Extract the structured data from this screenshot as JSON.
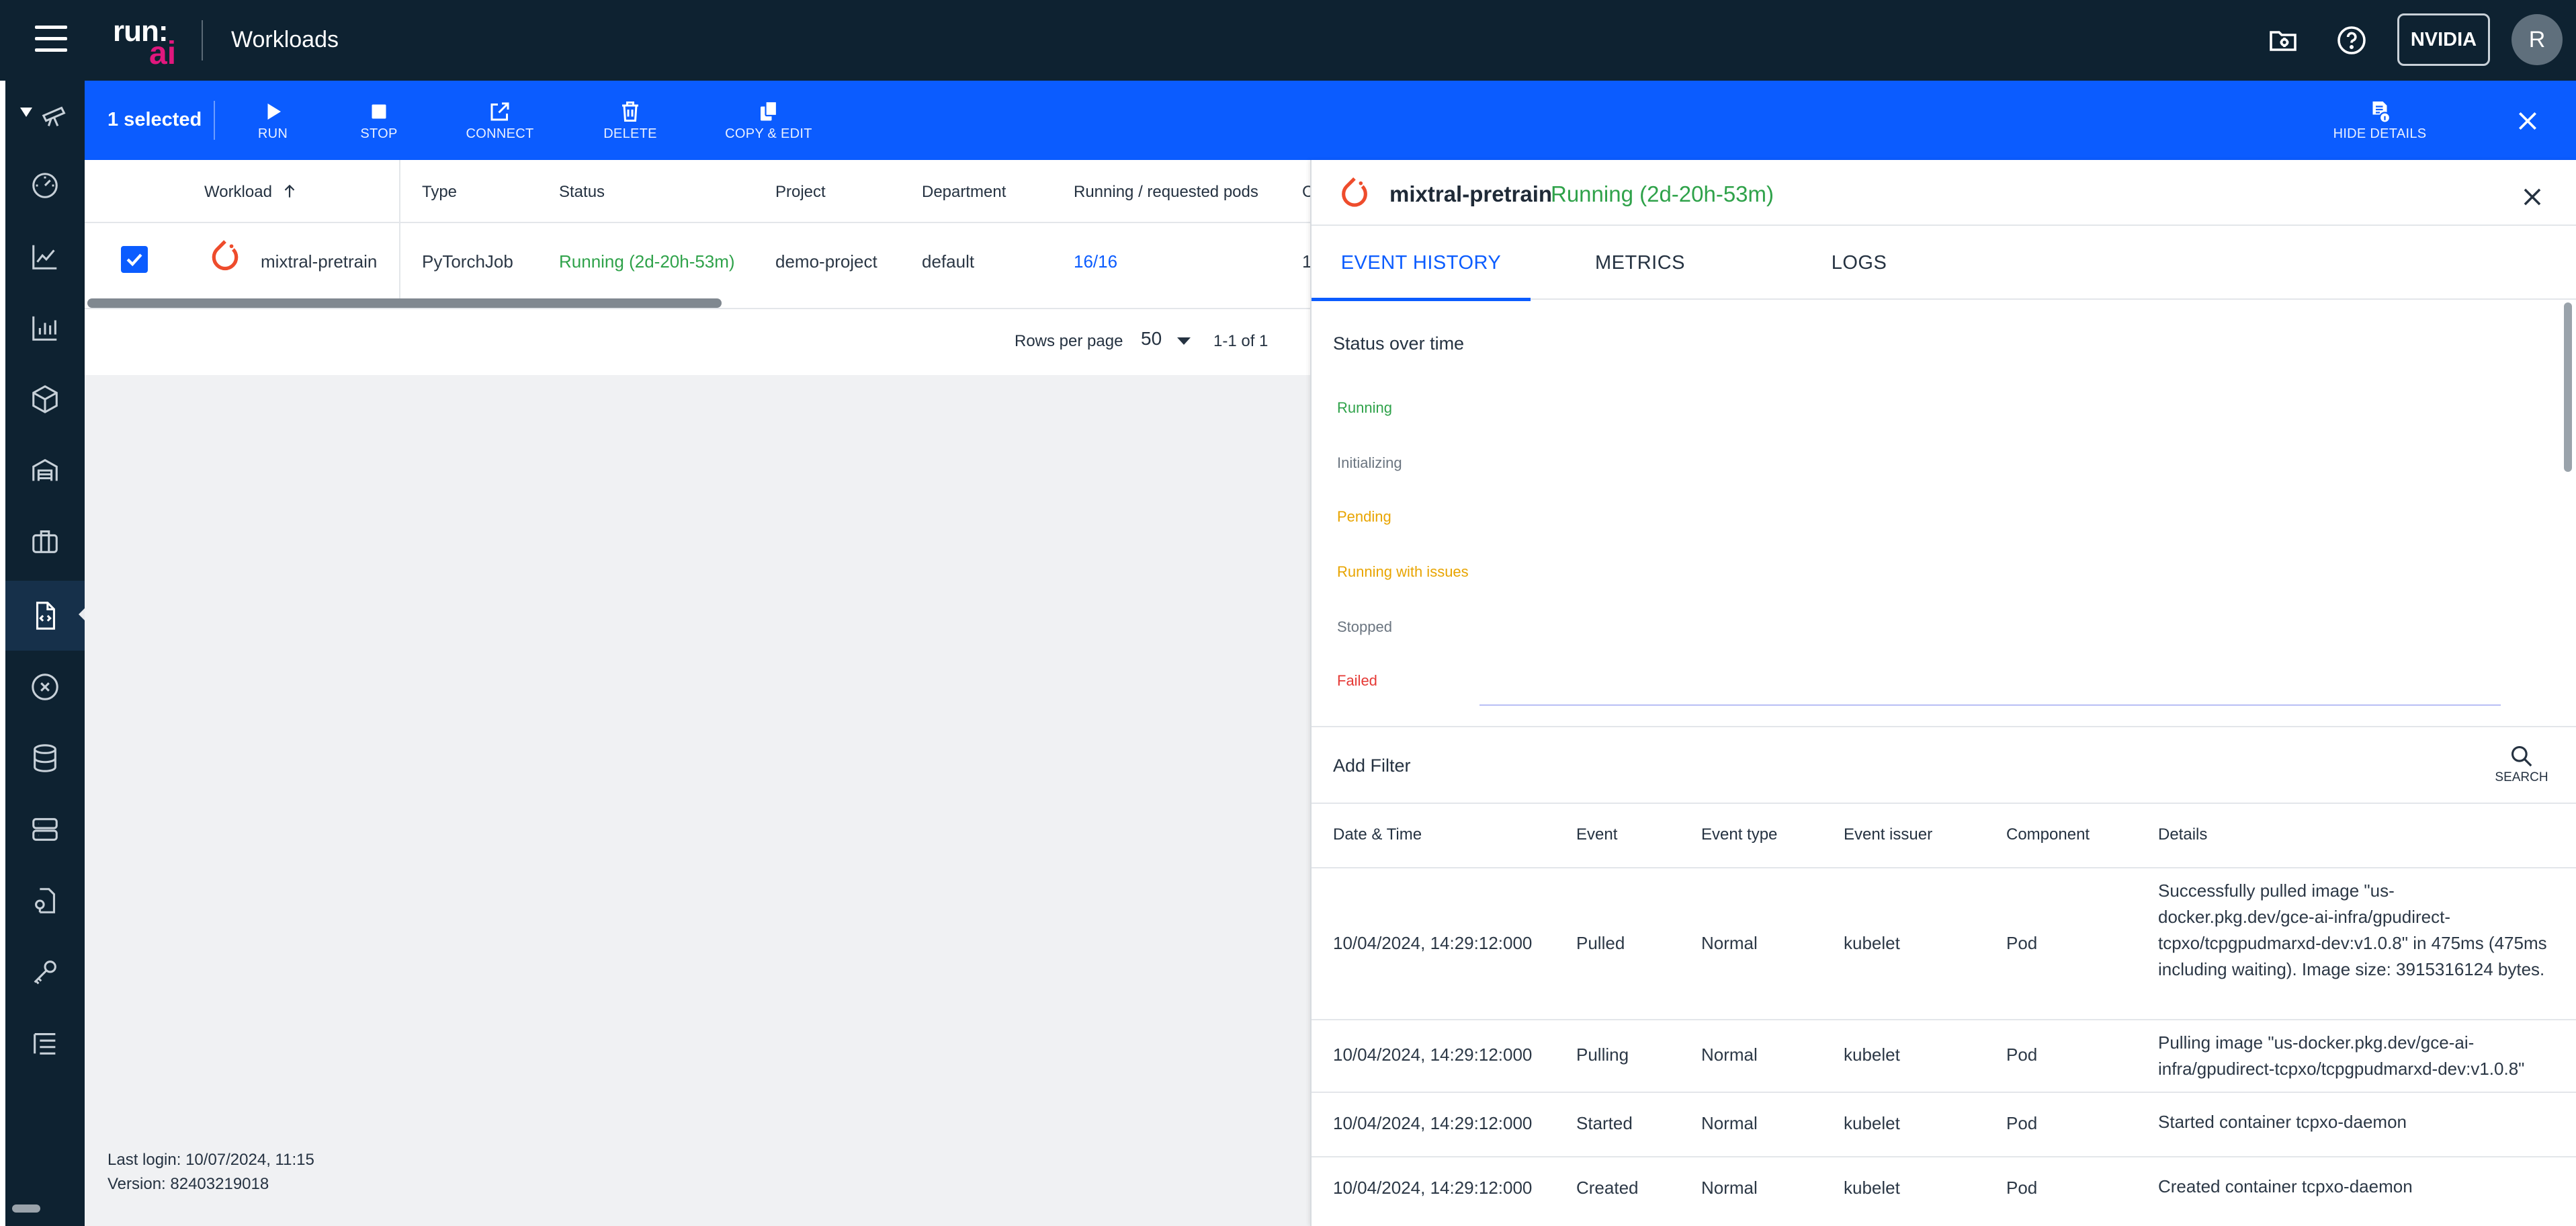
{
  "header": {
    "logo_top": "run:",
    "logo_bottom": "ai",
    "page_title": "Workloads",
    "org_label": "NVIDIA",
    "avatar_initial": "R"
  },
  "nav": {
    "icons": [
      "telescope-icon",
      "speedometer-icon",
      "line-chart-icon",
      "bar-chart-icon",
      "cube-icon",
      "warehouse-icon",
      "briefcase-icon",
      "workload-file-icon",
      "variable-icon",
      "database-icon",
      "server-icon",
      "credential-file-icon",
      "key-icon",
      "list-settings-icon"
    ],
    "active": "workload-file-icon"
  },
  "actionbar": {
    "selected": "1 selected",
    "actions": {
      "run": "RUN",
      "stop": "STOP",
      "connect": "CONNECT",
      "delete": "DELETE",
      "copy_edit": "COPY & EDIT"
    },
    "hide_details": "HIDE DETAILS"
  },
  "table": {
    "columns": {
      "workload": "Workload",
      "type": "Type",
      "status": "Status",
      "project": "Project",
      "department": "Department",
      "pods": "Running / requested pods",
      "truncated": "C"
    },
    "rows": [
      {
        "workload": "mixtral-pretrain",
        "type": "PyTorchJob",
        "status": "Running (2d-20h-53m)",
        "project": "demo-project",
        "department": "default",
        "pods": "16/16",
        "truncated": "1"
      }
    ],
    "pagination": {
      "rows_per_page_label": "Rows per page",
      "rows_per_page": "50",
      "range": "1-1 of 1"
    }
  },
  "footer": {
    "last_login": "Last login: 10/07/2024, 11:15",
    "version": "Version: 82403219018"
  },
  "details": {
    "workload_name": "mixtral-pretrain",
    "status": "Running (2d-20h-53m)",
    "tabs": {
      "events": "EVENT HISTORY",
      "metrics": "METRICS",
      "logs": "LOGS"
    },
    "chart": {
      "title": "Status over time",
      "statuses": {
        "running": "Running",
        "initializing": "Initializing",
        "pending": "Pending",
        "issues": "Running with issues",
        "stopped": "Stopped",
        "failed": "Failed"
      }
    },
    "filter": {
      "add_filter": "Add Filter",
      "search": "SEARCH"
    },
    "events_table": {
      "columns": {
        "datetime": "Date & Time",
        "event": "Event",
        "event_type": "Event type",
        "issuer": "Event issuer",
        "component": "Component",
        "details": "Details"
      },
      "rows": [
        {
          "datetime": "10/04/2024, 14:29:12:000",
          "event": "Pulled",
          "event_type": "Normal",
          "issuer": "kubelet",
          "component": "Pod",
          "details": "Successfully pulled image \"us-docker.pkg.dev/gce-ai-infra/gpudirect-tcpxo/tcpgpudmarxd-dev:v1.0.8\" in 475ms (475ms including waiting). Image size: 3915316124 bytes."
        },
        {
          "datetime": "10/04/2024, 14:29:12:000",
          "event": "Pulling",
          "event_type": "Normal",
          "issuer": "kubelet",
          "component": "Pod",
          "details": "Pulling image \"us-docker.pkg.dev/gce-ai-infra/gpudirect-tcpxo/tcpgpudmarxd-dev:v1.0.8\""
        },
        {
          "datetime": "10/04/2024, 14:29:12:000",
          "event": "Started",
          "event_type": "Normal",
          "issuer": "kubelet",
          "component": "Pod",
          "details": "Started container tcpxo-daemon"
        },
        {
          "datetime": "10/04/2024, 14:29:12:000",
          "event": "Created",
          "event_type": "Normal",
          "issuer": "kubelet",
          "component": "Pod",
          "details": "Created container tcpxo-daemon"
        }
      ]
    }
  },
  "colors": {
    "topbar": "#0e2231",
    "accent": "#0b5cff",
    "running": "#2fa24a",
    "pending": "#e8a400",
    "failed": "#e53935",
    "pytorch": "#ee4c2c"
  }
}
